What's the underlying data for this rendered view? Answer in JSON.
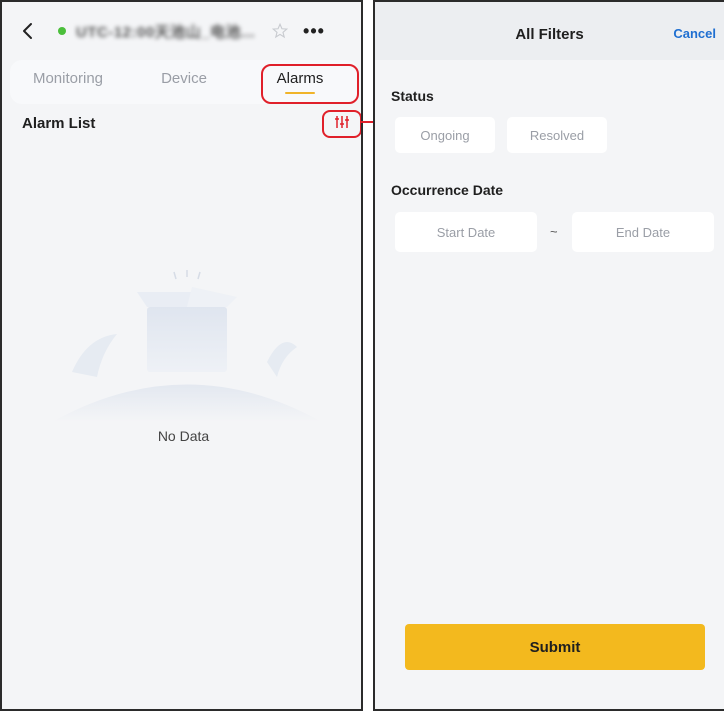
{
  "left": {
    "device_title": "UTC-12:00天池山_电池...",
    "tabs": [
      {
        "label": "Monitoring",
        "active": false
      },
      {
        "label": "Device",
        "active": false
      },
      {
        "label": "Alarms",
        "active": true
      }
    ],
    "alarm_list_title": "Alarm List",
    "empty_text": "No Data",
    "status_color": "#4bbf3b"
  },
  "right": {
    "title": "All Filters",
    "cancel_label": "Cancel",
    "status_label": "Status",
    "status_options": [
      "Ongoing",
      "Resolved"
    ],
    "date_label": "Occurrence Date",
    "start_placeholder": "Start Date",
    "date_separator": "~",
    "end_placeholder": "End Date",
    "submit_label": "Submit",
    "accent_color": "#f3b91e"
  },
  "annotation_color": "#e0202a",
  "icons": [
    "back-icon",
    "star-icon",
    "more-icon",
    "filter-icon",
    "arrow-icon"
  ]
}
